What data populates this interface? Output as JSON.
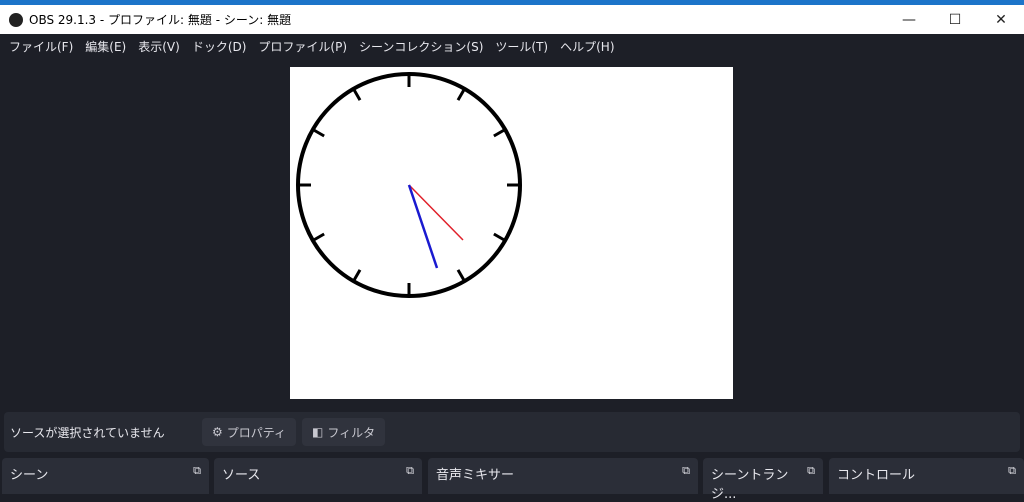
{
  "window": {
    "title": "OBS 29.1.3 - プロファイル: 無題 - シーン: 無題",
    "minimize": "—",
    "maximize": "☐",
    "close": "✕"
  },
  "menu": [
    "ファイル(F)",
    "編集(E)",
    "表示(V)",
    "ドック(D)",
    "プロファイル(P)",
    "シーンコレクション(S)",
    "ツール(T)",
    "ヘルプ(H)"
  ],
  "context_bar": {
    "message": "ソースが選択されていません",
    "properties": "プロパティ",
    "filters": "フィルタ"
  },
  "docks": [
    "シーン",
    "ソース",
    "音声ミキサー",
    "シーントランジ...",
    "コントロール"
  ],
  "colors": {
    "accent": "#1c74c9",
    "second_hand": "#e0202a",
    "minute_hand": "#1a1ad0"
  }
}
